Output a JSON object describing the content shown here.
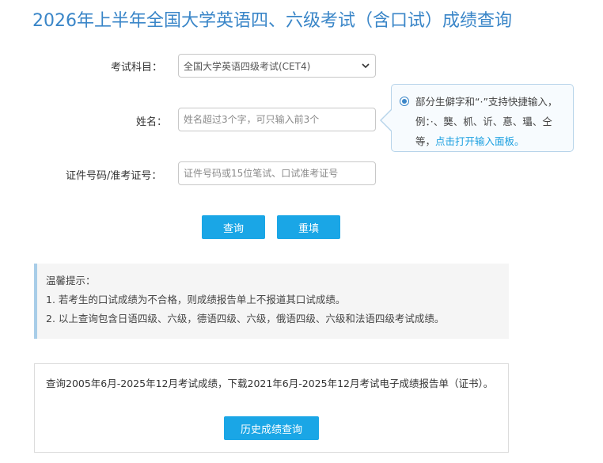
{
  "page": {
    "title": "2026年上半年全国大学英语四、六级考试（含口试）成绩查询"
  },
  "form": {
    "subject_label": "考试科目：",
    "subject_value": "全国大学英语四级考试(CET4)",
    "name_label": "姓名：",
    "name_placeholder": "姓名超过3个字，可只输入前3个",
    "id_label": "证件号码/准考证号：",
    "id_placeholder": "证件号码或15位笔试、口试准考证号",
    "query_button": "查询",
    "reset_button": "重填"
  },
  "tip": {
    "text": "部分生僻字和“·”支持快捷输入，例：·、龑、枛、䜣、惪、瓃、仝等，",
    "link": "点击打开输入面板。"
  },
  "notice": {
    "heading": "温馨提示：",
    "items": [
      "1. 若考生的口试成绩为不合格，则成绩报告单上不报道其口试成绩。",
      "2. 以上查询包含日语四级、六级，德语四级、六级，俄语四级、六级和法语四级考试成绩。"
    ]
  },
  "history": {
    "text": "查询2005年6月-2025年12月考试成绩，下载2021年6月-2025年12月考试电子成绩报告单（证书）。",
    "button": "历史成绩查询"
  },
  "colors": {
    "title": "#3a86c8",
    "button": "#1aa6e6",
    "link": "#1a9fe0"
  },
  "icons": [
    "chevron-down-icon",
    "radio-selected-icon"
  ]
}
